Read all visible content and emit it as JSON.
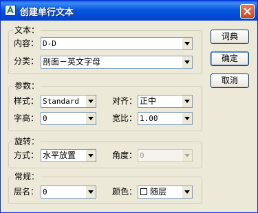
{
  "window": {
    "title": "创建单行文本",
    "app_icon": "text-tool-icon",
    "close_icon": "close-icon"
  },
  "text_group": {
    "legend": "文本：",
    "content_label": "内容：",
    "content_value": "D-D",
    "category_label": "分类：",
    "category_value": "剖面－英文字母"
  },
  "params_group": {
    "legend": "参数：",
    "style_label": "样式：",
    "style_value": "Standard",
    "align_label": "对齐：",
    "align_value": "正中",
    "height_label": "字高：",
    "height_value": "0",
    "width_ratio_label": "宽比：",
    "width_ratio_value": "1.00"
  },
  "rotation_group": {
    "legend": "旋转：",
    "mode_label": "方式：",
    "mode_value": "水平放置",
    "angle_label": "角度：",
    "angle_value": "0"
  },
  "general_group": {
    "legend": "常规：",
    "layer_label": "层名：",
    "layer_value": "0",
    "color_label": "颜色：",
    "color_value": "随层",
    "color_swatch": "#ffffff"
  },
  "buttons": {
    "dictionary": "词典",
    "ok": "确定",
    "cancel": "取消"
  }
}
